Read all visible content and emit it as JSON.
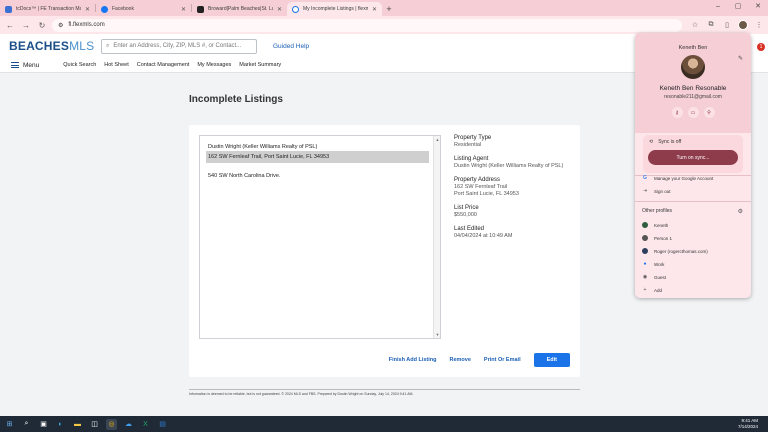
{
  "browser": {
    "tabs": [
      {
        "title": "tcDocs™ | FE Transaction Mana...",
        "color": "#3b6fd1"
      },
      {
        "title": "Facebook",
        "color": "#1877f2"
      },
      {
        "title": "Broward|Palm Beaches|St. Lucie...",
        "color": "#222222"
      },
      {
        "title": "My Incomplete Listings | flexmls",
        "color": "#1a73e8"
      }
    ],
    "url": "fl.flexmls.com"
  },
  "site": {
    "logo_main": "BEACHES",
    "logo_sub": "MLS",
    "search_placeholder": "Enter an Address, City, ZIP, MLS #, or Contact...",
    "guided_help": "Guided Help",
    "menu_label": "Menu",
    "nav": [
      "Quick Search",
      "Hot Sheet",
      "Contact Management",
      "My Messages",
      "Market Summary"
    ]
  },
  "main": {
    "title": "Incomplete Listings",
    "listbox": {
      "header": "Dustin Wright (Keller Williams Realty of PSL)",
      "selected": "162 SW Fernleaf Trail, Port Saint Lucie, FL 34953",
      "other": "540 SW North Carolina Drive."
    },
    "details": {
      "property_type_label": "Property Type",
      "property_type": "Residential",
      "agent_label": "Listing Agent",
      "agent": "Dustin Wright (Keller Williams Realty of PSL)",
      "address_label": "Property Address",
      "address_line1": "162 SW Fernleaf Trail",
      "address_line2": "Port Saint Lucie, FL 34953",
      "price_label": "List Price",
      "price": "$550,000",
      "edited_label": "Last Edited",
      "edited": "04/04/2024 at 10:49 AM"
    },
    "actions": {
      "finish": "Finish Add Listing",
      "remove": "Remove",
      "print": "Print Or Email",
      "edit": "Edit"
    },
    "footer": "Information is deemed to be reliable, but is not guaranteed. © 2024 MLS and FBS. Prepared by Dustin Wright on Sunday, July 14, 2024 9:41 AM."
  },
  "profile": {
    "greeting": "Keneth Ben",
    "name": "Keneth Ben Resonable",
    "email": "resonable211@gmail.com",
    "sync_status": "Sync is off",
    "sync_button": "Turn on sync...",
    "manage": "Manage your Google Account",
    "signout": "Sign out",
    "other_profiles": "Other profiles",
    "profiles": [
      {
        "name": "Keneth",
        "color": "#2e5e3e"
      },
      {
        "name": "Person 1",
        "color": "#555555"
      },
      {
        "name": "Roger (rogercthomas.com)",
        "color": "#2e3e5e"
      },
      {
        "name": "Work",
        "color": "#1a73e8"
      },
      {
        "name": "Guest",
        "color": "#777777"
      },
      {
        "name": "Add",
        "color": "#777777"
      }
    ],
    "notif_count": "1"
  },
  "taskbar": {
    "time": "9:41 AM",
    "date": "7/14/2024"
  }
}
